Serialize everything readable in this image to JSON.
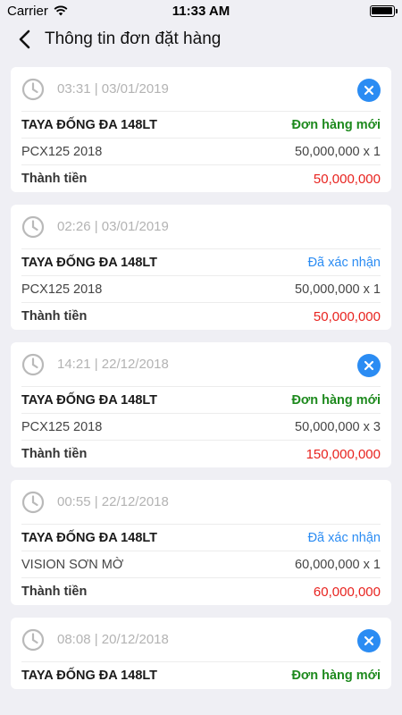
{
  "status_bar": {
    "carrier": "Carrier",
    "time": "11:33 AM"
  },
  "nav": {
    "title": "Thông tin đơn đặt hàng"
  },
  "orders": [
    {
      "time": "03:31 | 03/01/2019",
      "store": "TAYA ĐỐNG ĐA 148LT",
      "status": "Đơn hàng mới",
      "product": "PCX125 2018",
      "price_qty": "50,000,000 x 1",
      "total_label": "Thành tiền",
      "total": "50,000,000"
    },
    {
      "time": "02:26 | 03/01/2019",
      "store": "TAYA ĐỐNG ĐA 148LT",
      "status": "Đã xác nhận",
      "product": "PCX125 2018",
      "price_qty": "50,000,000 x 1",
      "total_label": "Thành tiền",
      "total": "50,000,000"
    },
    {
      "time": "14:21 | 22/12/2018",
      "store": "TAYA ĐỐNG ĐA 148LT",
      "status": "Đơn hàng mới",
      "product": "PCX125 2018",
      "price_qty": "50,000,000 x 3",
      "total_label": "Thành tiền",
      "total": "150,000,000"
    },
    {
      "time": "00:55 | 22/12/2018",
      "store": "TAYA ĐỐNG ĐA 148LT",
      "status": "Đã xác nhận",
      "product": "VISION SƠN MỜ",
      "price_qty": "60,000,000 x 1",
      "total_label": "Thành tiền",
      "total": "60,000,000"
    },
    {
      "time": "08:08 | 20/12/2018",
      "store": "TAYA ĐỐNG ĐA 148LT",
      "status": "Đơn hàng mới"
    }
  ],
  "colors": {
    "status_new": "#1e8a1e",
    "status_confirmed": "#2b8cf3",
    "total": "#e8231f",
    "cancel_button": "#2b8cf3"
  },
  "icons": {
    "back": "chevron-left-icon",
    "time": "clock-icon",
    "cancel": "close-circle-icon",
    "wifi": "wifi-icon",
    "battery": "battery-icon"
  }
}
